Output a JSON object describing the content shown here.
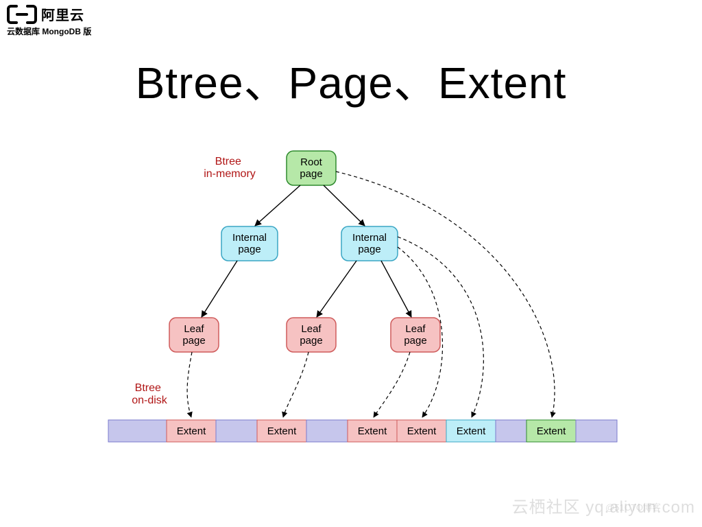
{
  "brand": {
    "name": "阿里云",
    "product": "云数据库 MongoDB 版"
  },
  "title": "Btree、Page、Extent",
  "labels": {
    "in_memory": "Btree\nin-memory",
    "on_disk": "Btree\non-disk"
  },
  "nodes": {
    "root": {
      "line1": "Root",
      "line2": "page"
    },
    "internal1": {
      "line1": "Internal",
      "line2": "page"
    },
    "internal2": {
      "line1": "Internal",
      "line2": "page"
    },
    "leaf1": {
      "line1": "Leaf",
      "line2": "page"
    },
    "leaf2": {
      "line1": "Leaf",
      "line2": "page"
    },
    "leaf3": {
      "line1": "Leaf",
      "line2": "page"
    }
  },
  "extents": {
    "e1": "Extent",
    "e2": "Extent",
    "e3": "Extent",
    "e4": "Extent",
    "e5": "Extent",
    "e6": "Extent"
  },
  "colors": {
    "root_fill": "#b6e8a8",
    "root_stroke": "#2e8a2e",
    "internal_fill": "#bdeef8",
    "internal_stroke": "#3aa6c4",
    "leaf_fill": "#f6c2c2",
    "leaf_stroke": "#cf5b5b",
    "spacer_fill": "#c6c6ec",
    "spacer_stroke": "#7a7acc",
    "extent_pink": "#f6c2c2",
    "extent_pink_stroke": "#cf5b5b",
    "extent_cyan": "#bdeef8",
    "extent_cyan_stroke": "#3aa6c4",
    "extent_green": "#b6e8a8",
    "extent_green_stroke": "#2e8a2e"
  },
  "watermarks": {
    "main": "云栖社区 yq.aliyun.com",
    "sub": "@51CTO博客"
  },
  "chart_data": {
    "type": "tree-diagram",
    "description": "Btree structure showing in-memory pages mapping to on-disk extents",
    "layers": [
      {
        "name": "root",
        "kind": "in-memory",
        "nodes": [
          "Root page"
        ]
      },
      {
        "name": "internal",
        "kind": "in-memory",
        "nodes": [
          "Internal page",
          "Internal page"
        ]
      },
      {
        "name": "leaf",
        "kind": "in-memory",
        "nodes": [
          "Leaf page",
          "Leaf page",
          "Leaf page"
        ]
      },
      {
        "name": "disk",
        "kind": "on-disk",
        "blocks": [
          "spacer",
          "Extent",
          "spacer",
          "Extent",
          "spacer",
          "Extent",
          "Extent",
          "Extent",
          "spacer",
          "Extent",
          "spacer"
        ]
      }
    ],
    "solid_edges": [
      [
        "Root page",
        "Internal page#1"
      ],
      [
        "Root page",
        "Internal page#2"
      ],
      [
        "Internal page#1",
        "Leaf page#1"
      ],
      [
        "Internal page#2",
        "Leaf page#2"
      ],
      [
        "Internal page#2",
        "Leaf page#3"
      ]
    ],
    "dashed_edges": [
      [
        "Leaf page#1",
        "Extent#1"
      ],
      [
        "Leaf page#2",
        "Extent#2"
      ],
      [
        "Leaf page#3",
        "Extent#3"
      ],
      [
        "Internal page#2",
        "Extent#4"
      ],
      [
        "Internal page#1",
        "Extent#5"
      ],
      [
        "Root page",
        "Extent#6"
      ]
    ],
    "extent_color_map": {
      "Extent#1": "pink",
      "Extent#2": "pink",
      "Extent#3": "pink",
      "Extent#4": "pink",
      "Extent#5": "cyan",
      "Extent#6": "green"
    }
  }
}
